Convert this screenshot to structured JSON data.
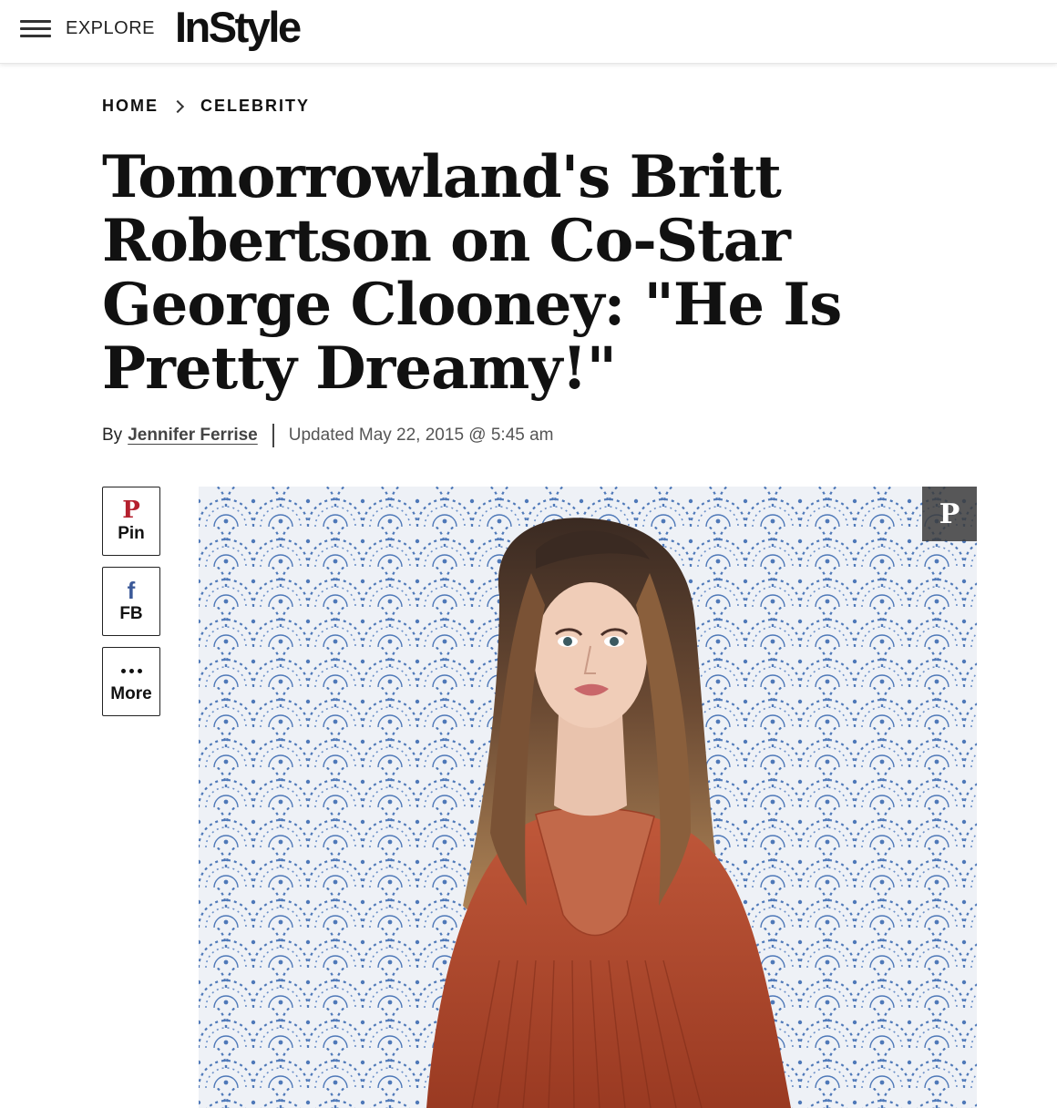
{
  "header": {
    "menu_label": "EXPLORE",
    "logo_text": "InStyle"
  },
  "breadcrumb": {
    "items": [
      "HOME",
      "CELEBRITY"
    ]
  },
  "article": {
    "title": "Tomorrowland's Britt Robertson on Co-Star George Clooney: \"He Is Pretty Dreamy!\"",
    "by_prefix": "By",
    "author": "Jennifer Ferrise",
    "updated": "Updated May 22, 2015 @ 5:45 am"
  },
  "share": {
    "pin_label": "Pin",
    "fb_label": "FB",
    "more_label": "More"
  },
  "colors": {
    "pinterest": "#b5202e",
    "facebook": "#3b5998",
    "dress": "#b24a2c",
    "pattern_blue": "#4e78b8"
  }
}
